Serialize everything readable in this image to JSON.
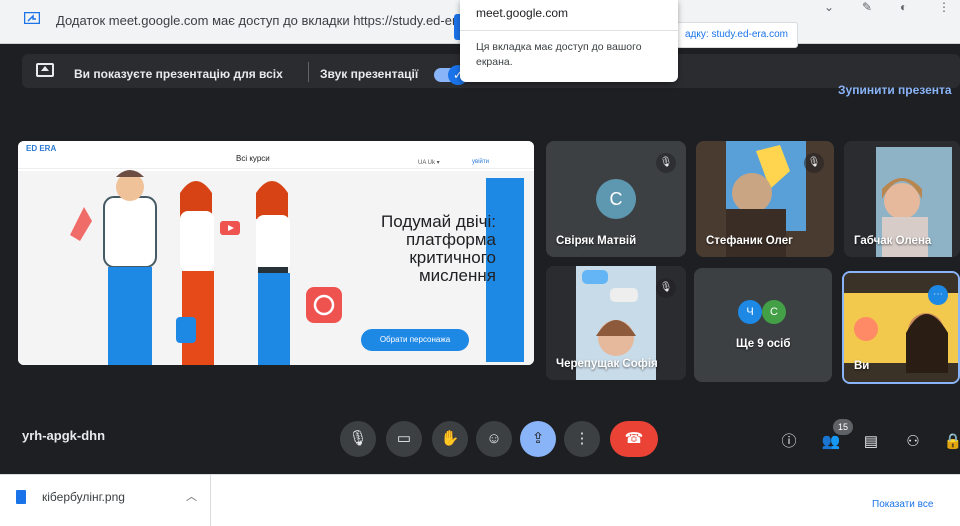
{
  "share_bar": {
    "message": "Додаток meet.google.com має доступ до вкладки https://study.ed-era.com",
    "tab_button": "адку: study.ed-era.com"
  },
  "popup": {
    "origin": "meet.google.com",
    "note": "Ця вкладка має доступ до вашого екрана."
  },
  "present_bar": {
    "title": "Ви показуєте презентацію для всіх",
    "sound_label": "Звук презентації",
    "sound_on": true,
    "stop_label": "Зупинити презента"
  },
  "slide": {
    "logo": "ED ERA",
    "nav": "Всі курси",
    "lang": "UA  Uk  ▾",
    "login": "увійти",
    "headline": "Подумай двічі: платформа критичного мислення",
    "cta": "Обрати персонажа"
  },
  "participants": [
    {
      "name": "Свіряк Матвій",
      "initial": "С",
      "muted": true
    },
    {
      "name": "Стефаник Олег",
      "muted": true
    },
    {
      "name": "Габчак Олена",
      "muted": false
    },
    {
      "name": "Черепущак Софія",
      "muted": true
    },
    {
      "name": "Ще 9 осіб",
      "initials": [
        "Ч",
        "С"
      ]
    },
    {
      "name": "Ви",
      "muted": false
    }
  ],
  "meeting": {
    "code": "yrh-apgk-dhn",
    "participant_count": "15"
  },
  "controls": {
    "mic": "mic-icon",
    "camera": "camera-icon",
    "hand": "hand-icon",
    "emoji": "emoji-icon",
    "present": "present-icon",
    "more": "more-icon",
    "end": "end-call-icon"
  },
  "colors": {
    "accent": "#8ab4f8",
    "end_call": "#ea4335",
    "background": "#1e1f22",
    "tile": "#3c4043"
  },
  "download_bar": {
    "filename": "кібербулінг.png",
    "show_all": "Показати все"
  }
}
